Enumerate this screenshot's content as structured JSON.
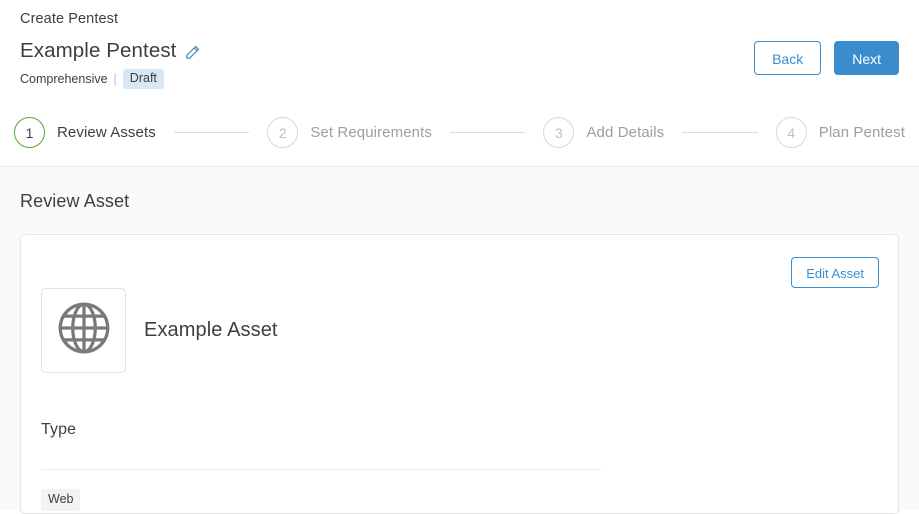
{
  "header": {
    "breadcrumb": "Create Pentest",
    "pentest_title": "Example Pentest",
    "edit_icon": "pencil-icon",
    "pentest_type": "Comprehensive",
    "separator": "|",
    "status_badge": "Draft",
    "back_label": "Back",
    "next_label": "Next",
    "accent_blue": "#3a8ccc",
    "badge_bg": "#d7e7f5"
  },
  "stepper": {
    "active_color": "#56a832",
    "steps": [
      {
        "number": "1",
        "label": "Review Assets",
        "active": true
      },
      {
        "number": "2",
        "label": "Set Requirements",
        "active": false
      },
      {
        "number": "3",
        "label": "Add Details",
        "active": false
      },
      {
        "number": "4",
        "label": "Plan Pentest",
        "active": false
      }
    ]
  },
  "main": {
    "section_title": "Review Asset",
    "edit_asset_label": "Edit Asset",
    "asset_icon": "globe-icon",
    "asset_name": "Example Asset",
    "type_label": "Type",
    "type_value": "Web"
  }
}
